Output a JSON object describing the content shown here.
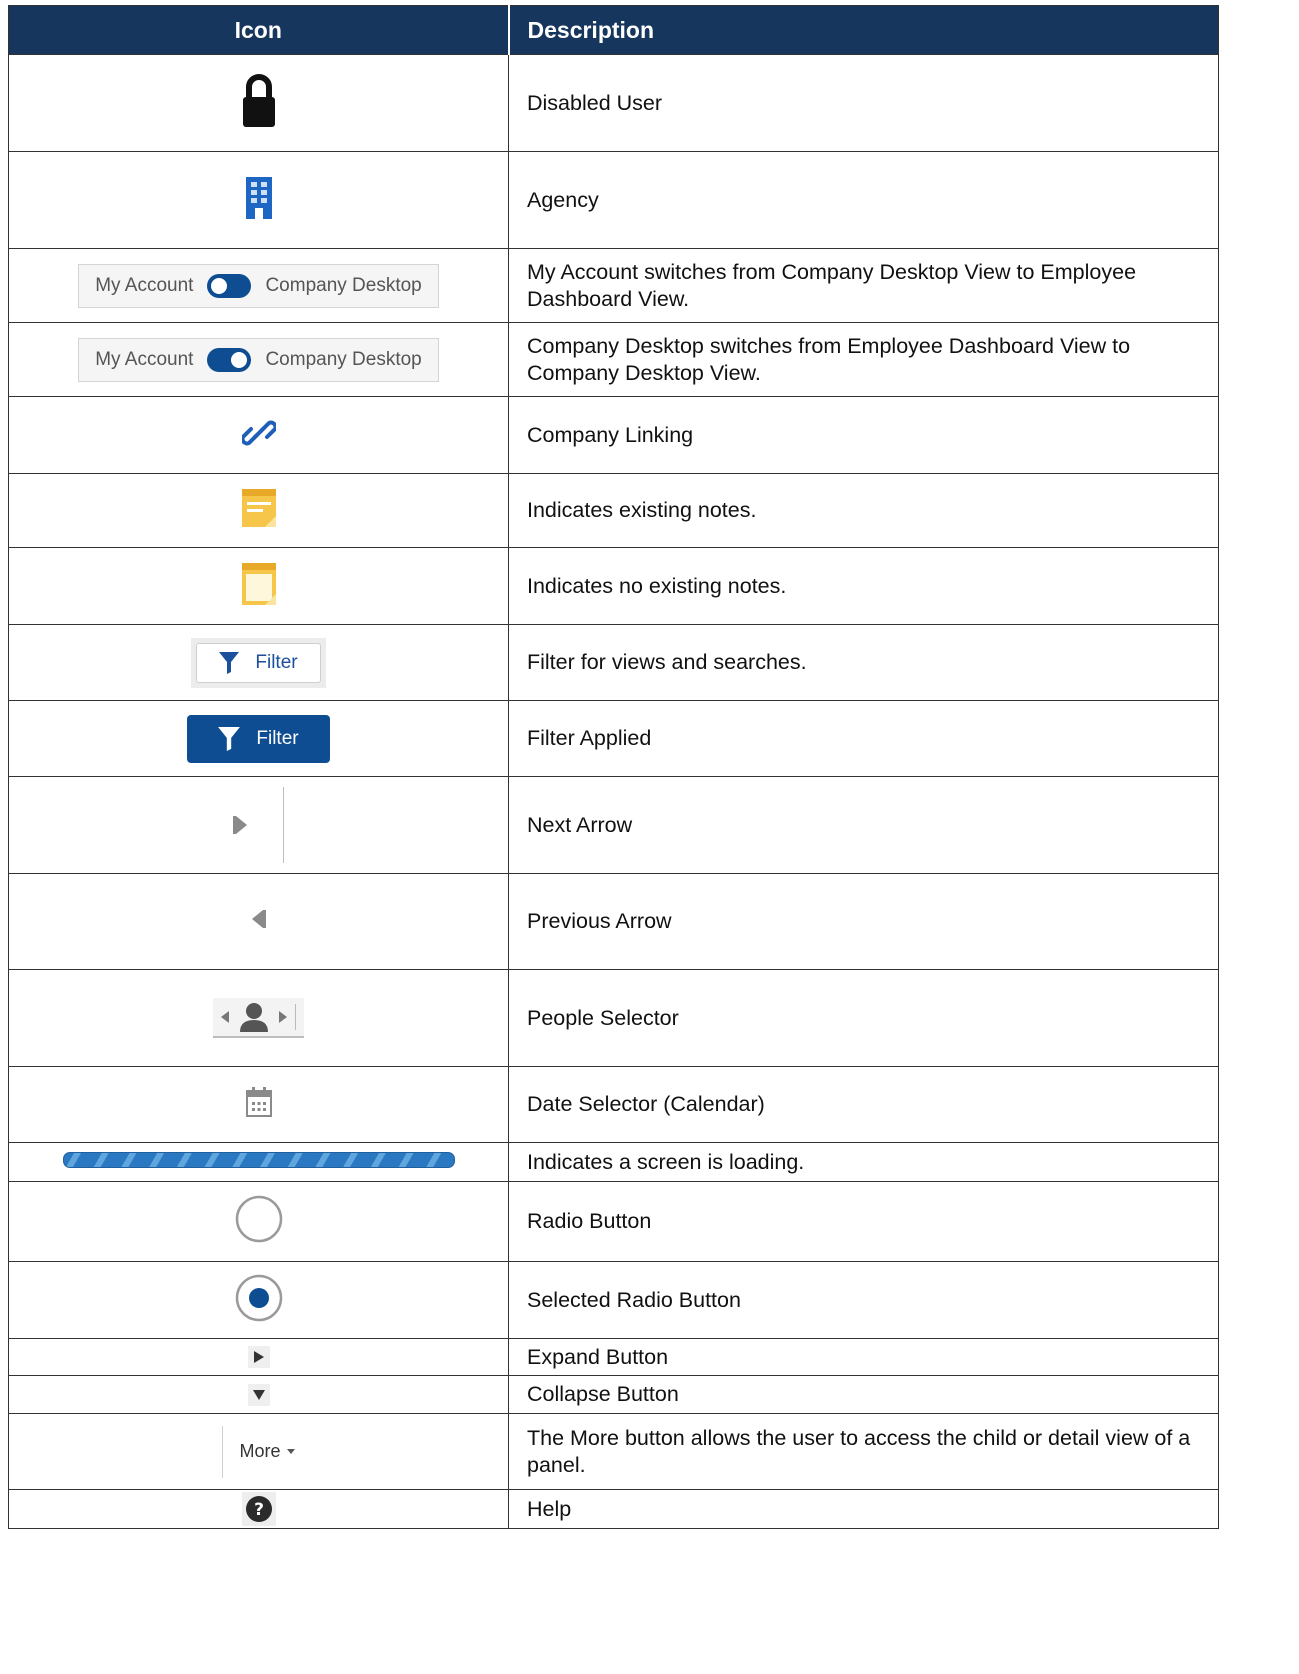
{
  "headers": {
    "icon": "Icon",
    "description": "Description"
  },
  "rows": [
    {
      "icon": "lock-icon",
      "description": "Disabled User"
    },
    {
      "icon": "building-icon",
      "description": "Agency"
    },
    {
      "icon": "toggle-off-icon",
      "description": "My Account switches from Company Desktop View to Employee Dashboard View."
    },
    {
      "icon": "toggle-on-icon",
      "description": "Company Desktop switches from Employee Dashboard View to Company Desktop View."
    },
    {
      "icon": "link-icon",
      "description": "Company Linking"
    },
    {
      "icon": "notes-existing-icon",
      "description": "Indicates existing notes."
    },
    {
      "icon": "notes-empty-icon",
      "description": "Indicates no existing notes."
    },
    {
      "icon": "filter-button",
      "description": "Filter for views and searches."
    },
    {
      "icon": "filter-applied-button",
      "description": "Filter Applied"
    },
    {
      "icon": "next-arrow-icon",
      "description": "Next Arrow"
    },
    {
      "icon": "previous-arrow-icon",
      "description": "Previous Arrow"
    },
    {
      "icon": "people-selector-icon",
      "description": "People Selector"
    },
    {
      "icon": "calendar-icon",
      "description": "Date Selector (Calendar)"
    },
    {
      "icon": "loading-bar",
      "description": "Indicates a screen is loading."
    },
    {
      "icon": "radio-icon",
      "description": "Radio Button"
    },
    {
      "icon": "radio-selected-icon",
      "description": "Selected Radio Button"
    },
    {
      "icon": "expand-icon",
      "description": "Expand Button"
    },
    {
      "icon": "collapse-icon",
      "description": "Collapse Button"
    },
    {
      "icon": "more-button",
      "description": "The More button allows the user to access the child or detail view of a panel."
    },
    {
      "icon": "help-icon",
      "description": "Help"
    }
  ],
  "toggle": {
    "left_label": "My Account",
    "right_label": "Company Desktop"
  },
  "filter": {
    "label": "Filter"
  },
  "more": {
    "label": "More"
  },
  "colors": {
    "header_bg": "#17365d",
    "brand_blue": "#0e4d92",
    "note_yellow": "#f6c64a"
  }
}
